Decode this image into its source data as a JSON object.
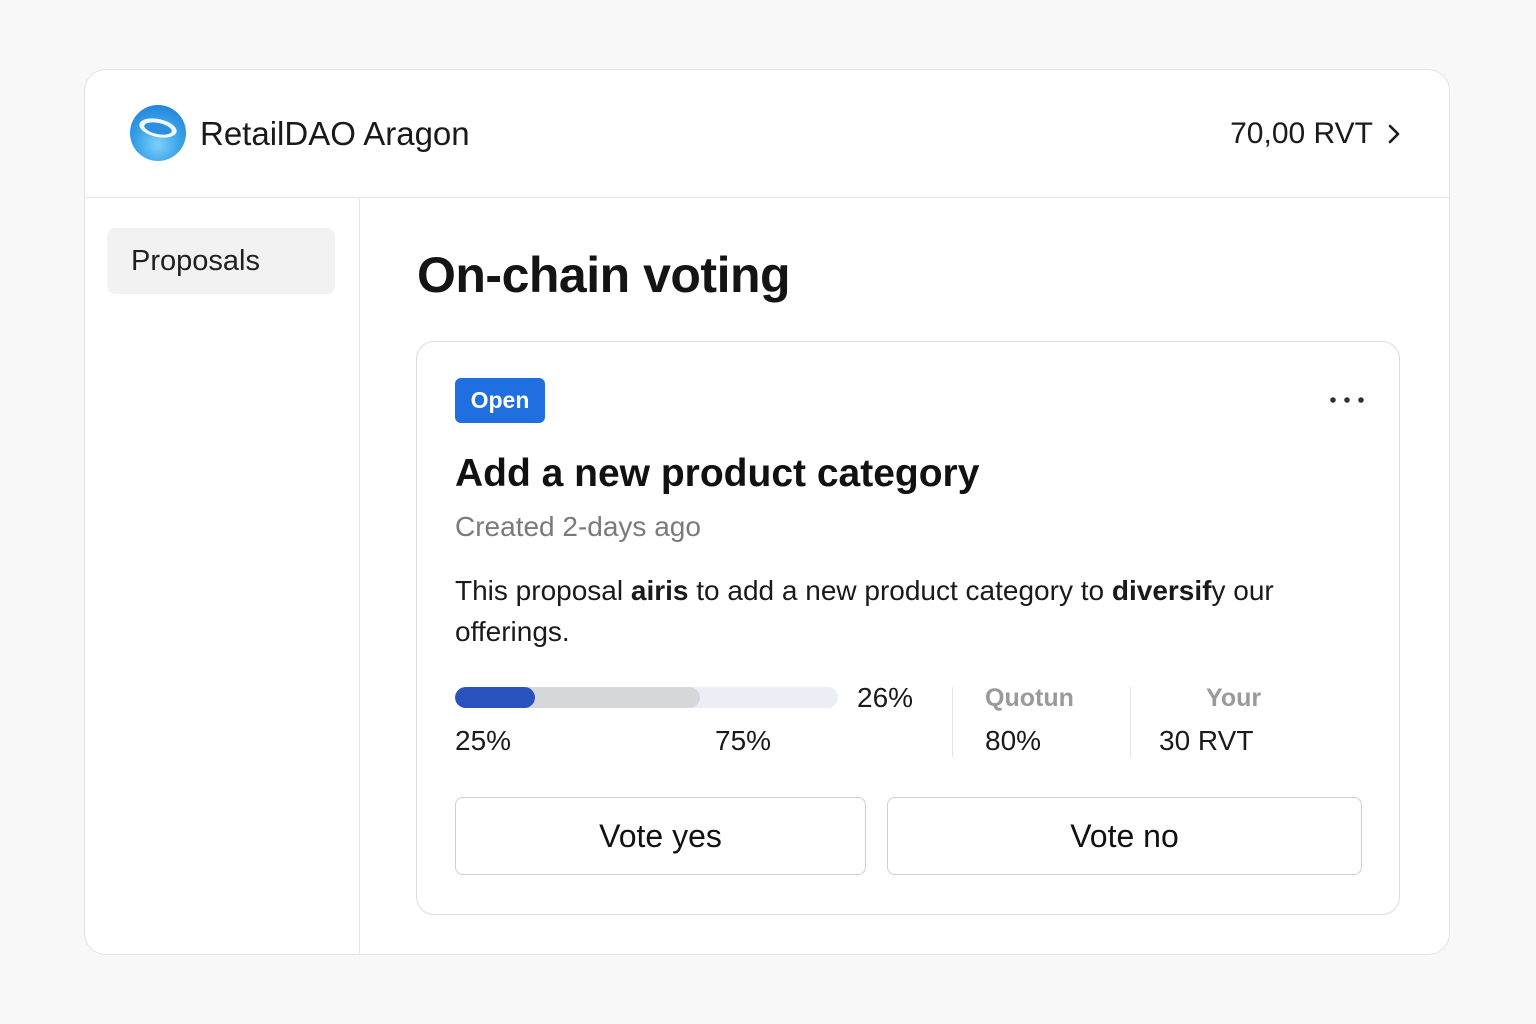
{
  "header": {
    "app_title": "RetailDAO Aragon",
    "balance": "70,00 RVT",
    "logo_icon": "dao-logo-icon",
    "balance_icon": "chevron-right-icon"
  },
  "sidebar": {
    "items": [
      {
        "label": "Proposals",
        "active": true
      }
    ]
  },
  "main": {
    "page_title": "On-chain voting"
  },
  "proposal": {
    "status": "Open",
    "status_color": "#1f6fe0",
    "menu_icon": "more-horizontal-icon",
    "title": "Add a new product category",
    "created": "Created 2-days ago",
    "description": {
      "part1": "This proposal ",
      "bold1": "airis",
      "part2": " to add a new product category to ",
      "bold2": "diversif",
      "part3": "y our offerings."
    },
    "progress": {
      "yes_fill_fraction": 0.21,
      "total_fill_fraction": 0.64,
      "fill_color": "#2a52be",
      "value_label": "26%",
      "left_label": "25%",
      "right_label": "75%"
    },
    "quorum": {
      "label": "Quotun",
      "value": "80%"
    },
    "your_vote": {
      "label": "Your",
      "value": "30 RVT"
    },
    "actions": {
      "vote_yes": "Vote yes",
      "vote_no": "Vote no"
    }
  }
}
